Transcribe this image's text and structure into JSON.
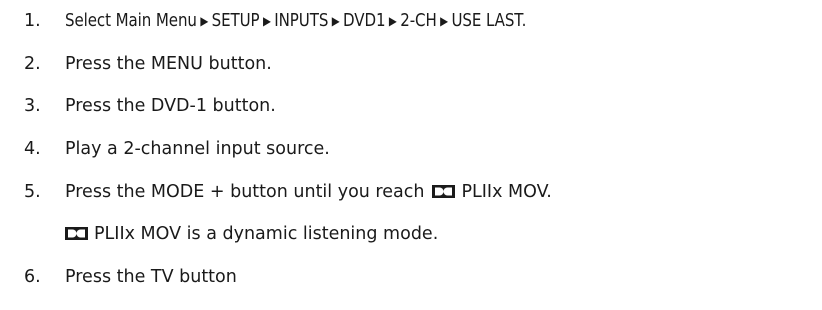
{
  "steps": [
    {
      "num": "1.",
      "path": [
        "Select Main Menu",
        "SETUP",
        "INPUTS",
        "DVD1",
        "2-CH",
        "USE LAST."
      ],
      "separator": "▶"
    },
    {
      "num": "2.",
      "text": "Press the MENU button."
    },
    {
      "num": "3.",
      "text": "Press the DVD-1 button."
    },
    {
      "num": "4.",
      "text": "Play a 2-channel input source."
    },
    {
      "num": "5.",
      "text_before": "Press the MODE + button until you reach",
      "mode_label": "PLIIx MOV."
    },
    {
      "num": "6.",
      "text": "Press the TV button"
    }
  ],
  "note": {
    "mode_label": "PLIIx MOV",
    "text": "is a dynamic listening mode."
  },
  "logo_icon": "dolby-double-d-icon"
}
